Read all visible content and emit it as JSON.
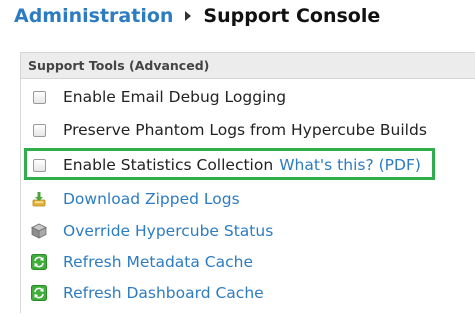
{
  "breadcrumb": {
    "parent": "Administration",
    "current": "Support Console"
  },
  "panel": {
    "title": "Support Tools (Advanced)"
  },
  "options": [
    {
      "label": "Enable Email Debug Logging",
      "checked": false
    },
    {
      "label": "Preserve Phantom Logs from Hypercube Builds",
      "checked": false
    },
    {
      "label": "Enable Statistics Collection",
      "checked": false,
      "help_link": "What's this? (PDF)"
    }
  ],
  "actions": [
    {
      "label": "Download Zipped Logs",
      "icon": "download-icon"
    },
    {
      "label": "Override Hypercube Status",
      "icon": "cube-icon"
    },
    {
      "label": "Refresh Metadata Cache",
      "icon": "refresh-icon"
    },
    {
      "label": "Refresh Dashboard Cache",
      "icon": "refresh-icon"
    }
  ],
  "colors": {
    "link": "#2d7cc1",
    "highlight": "#2fae4b",
    "header_bg": "#ececec"
  }
}
